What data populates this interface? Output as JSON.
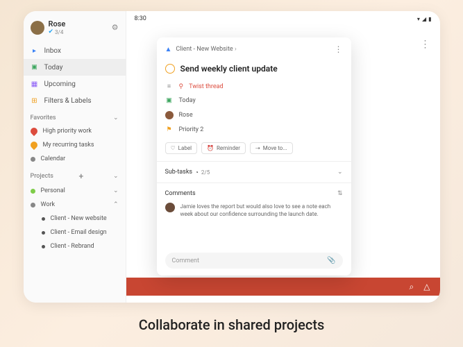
{
  "user": {
    "name": "Rose",
    "progress": "3/4"
  },
  "sidebar": {
    "nav": [
      {
        "label": "Inbox",
        "icon": "▣"
      },
      {
        "label": "Today",
        "icon": "▣"
      },
      {
        "label": "Upcoming",
        "icon": "▦"
      },
      {
        "label": "Filters & Labels",
        "icon": "⊞"
      }
    ],
    "favorites_label": "Favorites",
    "favorites": [
      {
        "label": "High priority work",
        "color": "#dc4c3e"
      },
      {
        "label": "My recurring tasks",
        "color": "#f0a020"
      },
      {
        "label": "Calendar",
        "color": "#888"
      }
    ],
    "projects_label": "Projects",
    "projects": [
      {
        "label": "Personal",
        "color": "#7ecc49"
      },
      {
        "label": "Work",
        "color": "#888",
        "expanded": true
      }
    ],
    "subprojects": [
      {
        "label": "Client - New website"
      },
      {
        "label": "Client - Email design"
      },
      {
        "label": "Client - Rebrand"
      }
    ]
  },
  "status": {
    "time": "8:30"
  },
  "modal": {
    "breadcrumb": "Client - New Website",
    "task_title": "Send weekly client update",
    "twist_label": "Twist thread",
    "date_label": "Today",
    "assignee": "Rose",
    "priority": "Priority 2",
    "chips": [
      {
        "label": "Label"
      },
      {
        "label": "Reminder"
      },
      {
        "label": "Move to..."
      }
    ],
    "subtasks_label": "Sub-tasks",
    "subtasks_count": "2/5",
    "comments_label": "Comments",
    "comment_text": "Jamie loves the report but would also love to see a note each week about our confidence surrounding the launch date.",
    "comment_placeholder": "Comment"
  },
  "caption": "Collaborate in shared projects"
}
